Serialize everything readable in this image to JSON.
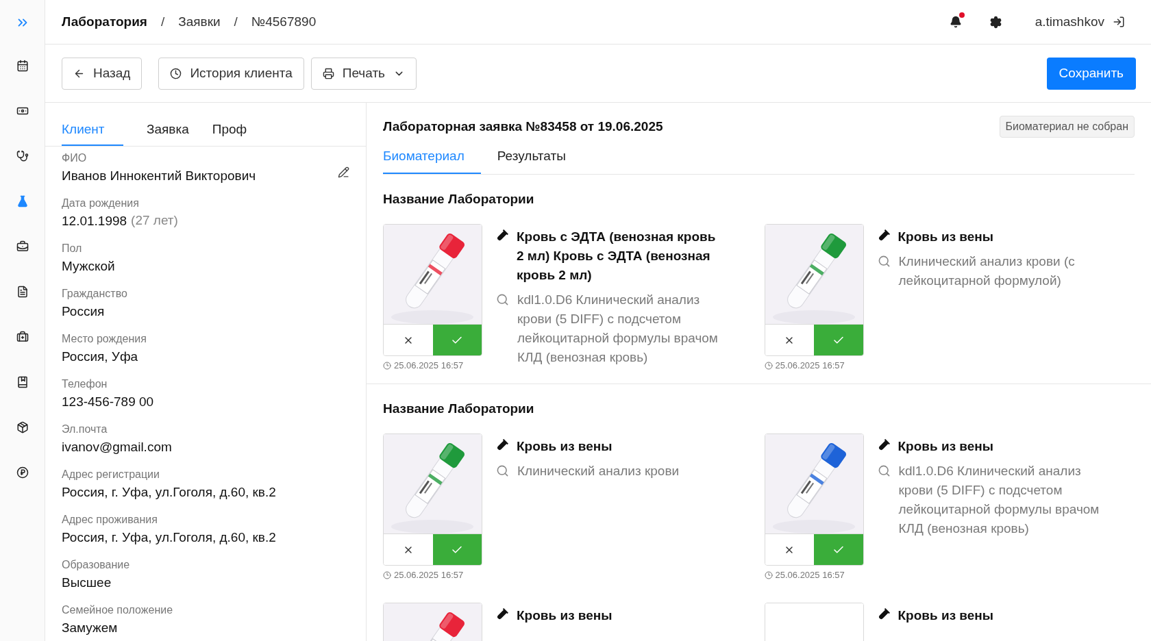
{
  "sidebar": {
    "items": [
      {
        "selected": false
      },
      {
        "selected": false
      },
      {
        "selected": false
      },
      {
        "selected": true
      },
      {
        "selected": false
      },
      {
        "selected": false
      },
      {
        "selected": false
      },
      {
        "selected": false
      },
      {
        "selected": false
      },
      {
        "selected": false
      }
    ]
  },
  "breadcrumbs": [
    {
      "label": "Лаборатория",
      "kind": "link"
    },
    {
      "label": "/",
      "kind": "separator"
    },
    {
      "label": "Заявки",
      "kind": "link"
    },
    {
      "label": "/",
      "kind": "separator"
    },
    {
      "label": "№4567890",
      "kind": "link"
    }
  ],
  "user": {
    "name": "a.timashkov",
    "has_notifications": true
  },
  "toolbar": {
    "back": "Назад",
    "history": "История клиента",
    "print": "Печать",
    "save": "Сохранить"
  },
  "client_tabs": [
    {
      "label": "Клиент",
      "selected": true
    },
    {
      "label": "Заявка",
      "selected": false
    },
    {
      "label": "Проф",
      "selected": false
    }
  ],
  "client_fields": [
    {
      "label": "ФИО",
      "value": "Иванов Иннокентий Викторович",
      "editable": true
    },
    {
      "label": "Дата рождения",
      "value": "12.01.1998",
      "note": "(27 лет)"
    },
    {
      "label": "Пол",
      "value": "Мужской"
    },
    {
      "label": "Гражданство",
      "value": "Россия"
    },
    {
      "label": "Место рождения",
      "value": "Россия, Уфа"
    },
    {
      "label": "Телефон",
      "value": "123-456-789 00"
    },
    {
      "label": "Эл.почта",
      "value": "ivanov@gmail.com"
    },
    {
      "label": "Адрес регистрации",
      "value": "Россия, г. Уфа, ул.Гоголя, д.60, кв.2"
    },
    {
      "label": "Адрес проживания",
      "value": "Россия, г. Уфа, ул.Гоголя, д.60, кв.2"
    },
    {
      "label": "Образование",
      "value": "Высшее"
    },
    {
      "label": "Семейное положение",
      "value": "Замужем"
    }
  ],
  "order": {
    "title": "Лабораторная заявка №83458 от 19.06.2025",
    "status": "Биоматериал не собран"
  },
  "order_tabs": [
    {
      "label": "Биоматериал",
      "selected": true
    },
    {
      "label": "Результаты",
      "selected": false
    }
  ],
  "sections": [
    {
      "title": "Название Лаборатории",
      "samples": [
        {
          "color": "#e8243a",
          "title": "Кровь с ЭДТА (венозная кровь 2 мл) Кровь с ЭДТА (венозная кровь 2 мл)",
          "analysis": "kdl1.0.D6 Клинический анализ крови (5 DIFF) с подсчетом лейкоцитарной формулы врачом КЛД (венозная кровь)",
          "time": "25.06.2025 16:57",
          "accepted": true
        },
        {
          "color": "#1f9a3c",
          "title": "Кровь из вены",
          "analysis": "Клинический анализ крови (с лейкоцитарной формулой)",
          "time": "25.06.2025 16:57",
          "accepted": true
        }
      ]
    },
    {
      "title": "Название Лаборатории",
      "samples": [
        {
          "color": "#1f9a3c",
          "title": "Кровь из вены",
          "analysis": "Клинический анализ крови",
          "time": "25.06.2025 16:57",
          "accepted": true
        },
        {
          "color": "#1e63d8",
          "title": "Кровь из вены",
          "analysis": "kdl1.0.D6 Клинический анализ крови (5 DIFF) с подсчетом лейкоцитарной формулы врачом КЛД (венозная кровь)",
          "time": "25.06.2025 16:57",
          "accepted": true
        },
        {
          "color": "#e8243a",
          "title": "Кровь из вены"
        },
        {
          "title": "Кровь из вены"
        }
      ]
    }
  ]
}
